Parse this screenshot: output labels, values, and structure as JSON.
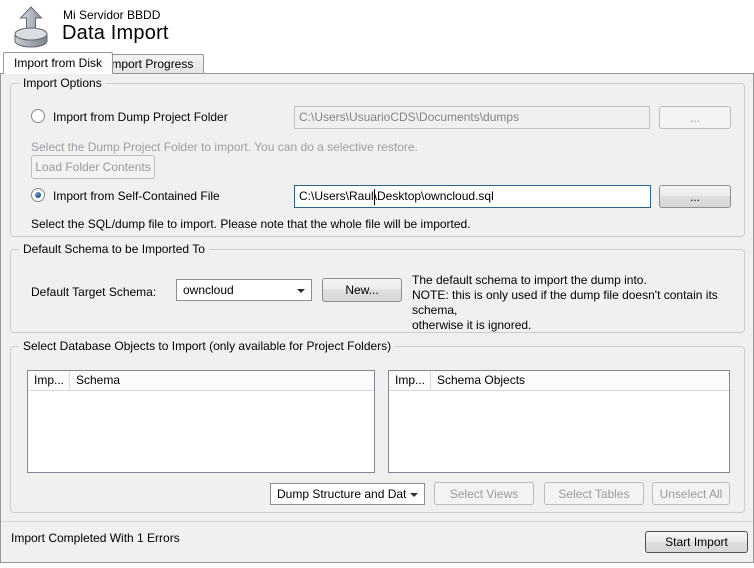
{
  "header": {
    "connection_name": "Mi Servidor BBDD",
    "title": "Data Import"
  },
  "tabs": {
    "import_from_disk": "Import from Disk",
    "import_progress": "Import Progress"
  },
  "import_options": {
    "group_title": "Import Options",
    "dump_folder": {
      "radio_label": "Import from Dump Project Folder",
      "path_value": "C:\\Users\\UsuarioCDS\\Documents\\dumps",
      "browse_label": "...",
      "help_text": "Select the Dump Project Folder to import. You can do a selective restore.",
      "load_button_label": "Load Folder Contents"
    },
    "self_contained": {
      "radio_label": "Import from Self-Contained File",
      "path_value": "C:\\Users\\Raul\\Desktop\\owncloud.sql",
      "browse_label": "...",
      "help_text": "Select the SQL/dump file to import. Please note that the whole file will be imported."
    }
  },
  "default_schema": {
    "group_title": "Default Schema to be Imported To",
    "label": "Default Target Schema:",
    "selected_value": "owncloud",
    "new_button_label": "New...",
    "note": "The default schema to import the dump into.\nNOTE: this is only used if the dump file doesn't contain its schema,\notherwise it is ignored."
  },
  "object_selection": {
    "group_title": "Select Database Objects to Import (only available for Project Folders)",
    "schema_list": {
      "columns": [
        "Imp...",
        "Schema"
      ],
      "rows": []
    },
    "objects_list": {
      "columns": [
        "Imp...",
        "Schema Objects"
      ],
      "rows": []
    },
    "dump_type_selected": "Dump Structure and Dat",
    "select_views_label": "Select Views",
    "select_tables_label": "Select Tables",
    "unselect_all_label": "Unselect All"
  },
  "footer": {
    "status_text": "Import Completed With 1 Errors",
    "start_button_label": "Start Import"
  },
  "colors": {
    "panel_bg": "#f0f0f0",
    "focus_border": "#2c628b",
    "radio_dot": "#2a5b8c",
    "disabled_text": "#9a9a9a"
  }
}
